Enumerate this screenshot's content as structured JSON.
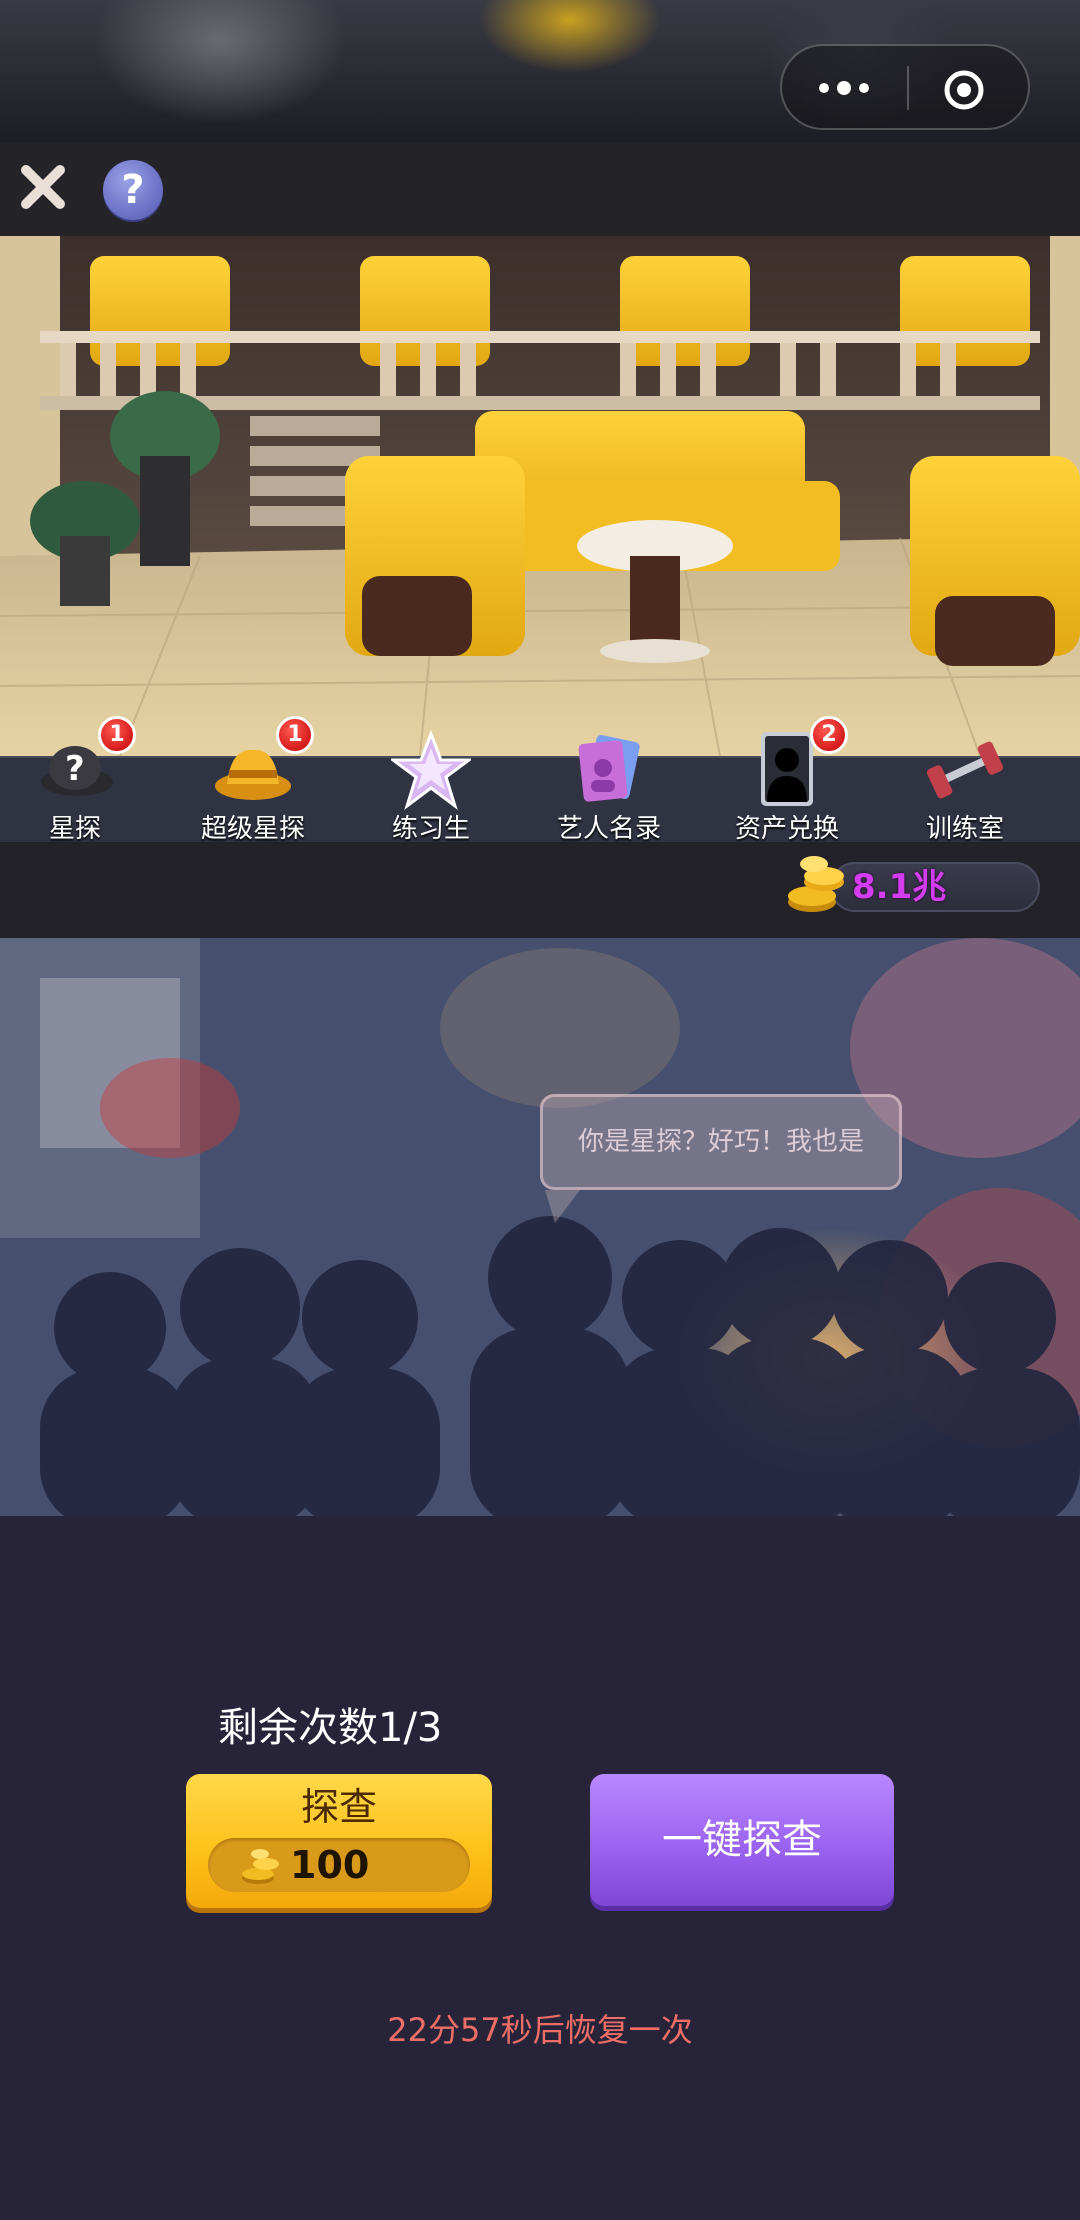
{
  "header": {
    "close_icon": "close-icon",
    "help_label": "?"
  },
  "menu": {
    "items": [
      {
        "label": "星探",
        "icon": "spy-hat-icon",
        "badge": "1"
      },
      {
        "label": "超级星探",
        "icon": "fedora-hat-icon",
        "badge": "1"
      },
      {
        "label": "练习生",
        "icon": "star-icon",
        "badge": ""
      },
      {
        "label": "艺人名录",
        "icon": "photo-cards-icon",
        "badge": ""
      },
      {
        "label": "资产兑换",
        "icon": "silhouette-card-icon",
        "badge": "2"
      },
      {
        "label": "训练室",
        "icon": "dumbbell-icon",
        "badge": ""
      }
    ]
  },
  "currency": {
    "value": "8.1兆",
    "icon": "gold-coins-icon"
  },
  "banner": {
    "speech": "你是星探？好巧！我也是"
  },
  "scout": {
    "remaining": "剩余次数1/3",
    "probe_label": "探查",
    "probe_cost": "100",
    "one_key_label": "一键探查",
    "recover_text": "22分57秒后恢复一次"
  },
  "colors": {
    "coin_text": "#d43cf0",
    "probe_button": "#ffc21c",
    "one_key_button": "#9a63f0",
    "recover_text": "#ee6e67",
    "badge": "#d41a1a"
  }
}
